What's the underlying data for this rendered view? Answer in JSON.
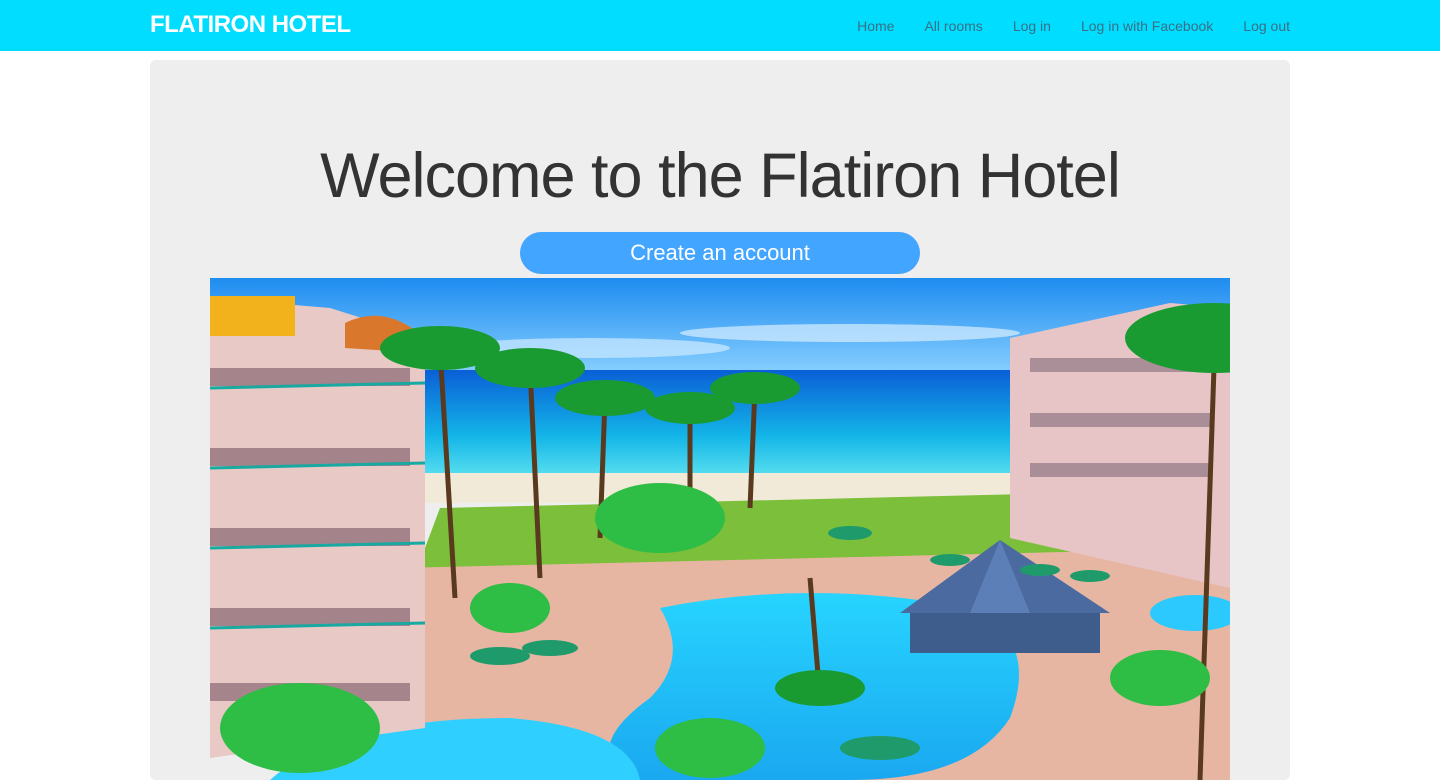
{
  "navbar": {
    "brand": "FLATIRON HOTEL",
    "links": [
      "Home",
      "All rooms",
      "Log in",
      "Log in with Facebook",
      "Log out"
    ],
    "background_color": "#00ddff"
  },
  "main": {
    "title": "Welcome to the Flatiron Hotel",
    "cta_label": "Create an account",
    "cta_color": "#42a5ff"
  },
  "hero_image": {
    "subject": "beach resort with pool, palm trees and ocean"
  }
}
